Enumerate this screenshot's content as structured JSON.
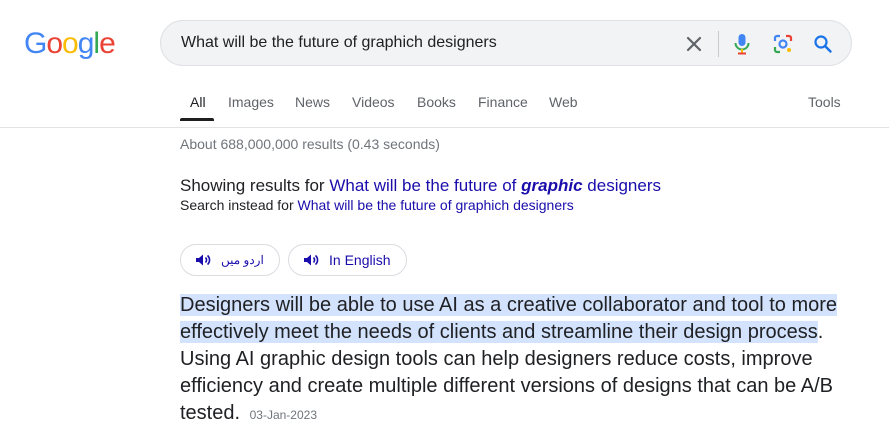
{
  "logo": {
    "letters": [
      "G",
      "o",
      "o",
      "g",
      "l",
      "e"
    ],
    "colors": [
      "#4285f4",
      "#ea4335",
      "#fbbc05",
      "#4285f4",
      "#34a853",
      "#ea4335"
    ]
  },
  "search": {
    "query": "What will be the future of graphich designers",
    "icons": [
      "close-icon",
      "microphone-icon",
      "lens-icon",
      "search-icon"
    ]
  },
  "tabs": [
    "All",
    "Images",
    "News",
    "Videos",
    "Books",
    "Finance",
    "Web"
  ],
  "active_tab": "All",
  "tools_label": "Tools",
  "stats": "About 688,000,000 results (0.43 seconds)",
  "correction": {
    "showing_prefix": "Showing results for",
    "corrected_part1": "What will be the future of",
    "corrected_bold": "graphic",
    "corrected_part2": "designers",
    "instead_prefix": "Search instead for",
    "instead_query": "What will be the future of graphich designers"
  },
  "listen": {
    "urdu_label": "اردو میں",
    "english_label": "In English"
  },
  "snippet": {
    "highlighted": "Designers will be able to use AI as a creative collaborator and tool to more effectively meet the needs of clients and streamline their design process",
    "rest": ". Using AI graphic design tools can help designers reduce costs, improve efficiency and create multiple different versions of designs that can be A/B tested.",
    "date": "03-Jan-2023"
  }
}
